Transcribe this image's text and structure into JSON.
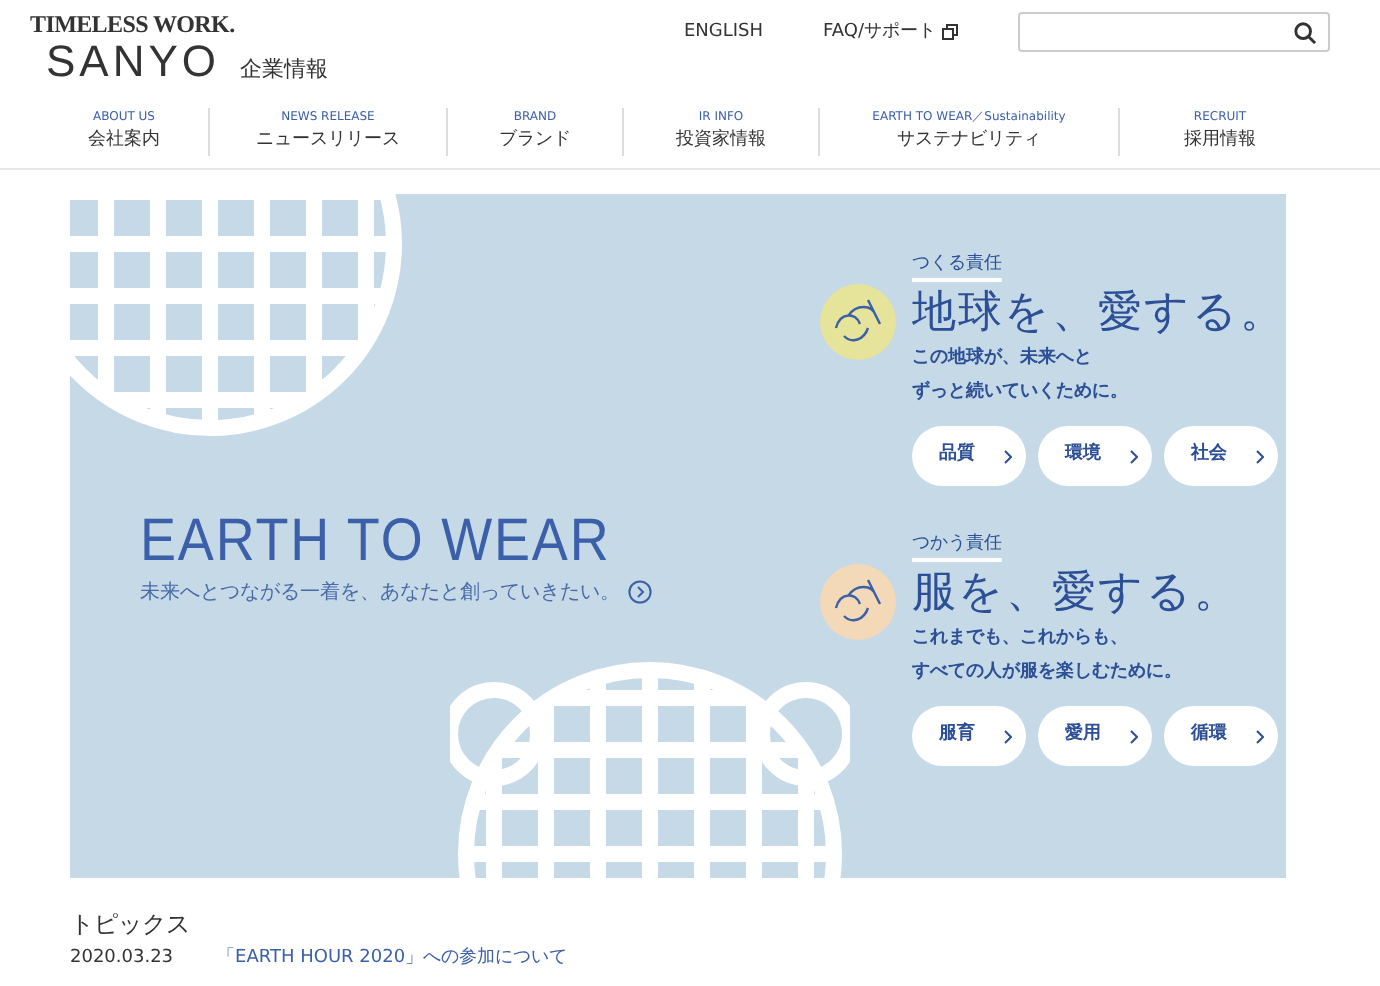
{
  "header": {
    "brand_tagline": "TIMELESS WORK.",
    "brand_name": "SANYO",
    "site_label": "企業情報",
    "links": [
      {
        "label": "ENGLISH",
        "external": false
      },
      {
        "label": "FAQ/サポート",
        "external": true
      }
    ]
  },
  "nav": [
    {
      "en": "ABOUT US",
      "ja": "会社案内"
    },
    {
      "en": "NEWS RELEASE",
      "ja": "ニュースリリース"
    },
    {
      "en": "BRAND",
      "ja": "ブランド"
    },
    {
      "en": "IR INFO",
      "ja": "投資家情報"
    },
    {
      "en": "EARTH TO WEAR／Sustainability",
      "ja": "サステナビリティ"
    },
    {
      "en": "RECRUIT",
      "ja": "採用情報"
    }
  ],
  "banner": {
    "title": "EARTH TO WEAR",
    "subtitle": "未来へとつながる一着を、あなたと創っていきたい。",
    "sections": [
      {
        "label": "つくる責任",
        "heading": "地球を、愛する。",
        "lines": [
          "この地球が、未来へと",
          "ずっと続いていくために。"
        ],
        "color": "#e6e39a",
        "buttons": [
          "品質",
          "環境",
          "社会"
        ]
      },
      {
        "label": "つかう責任",
        "heading": "服を、愛する。",
        "lines": [
          "これまでも、これからも、",
          "すべての人が服を楽しむために。"
        ],
        "color": "#f3d9b8",
        "buttons": [
          "服育",
          "愛用",
          "循環"
        ]
      }
    ]
  },
  "topics": {
    "title": "トピックス",
    "items": [
      {
        "date": "2020.03.23",
        "text": "「EARTH HOUR 2020」への参加について"
      }
    ]
  }
}
